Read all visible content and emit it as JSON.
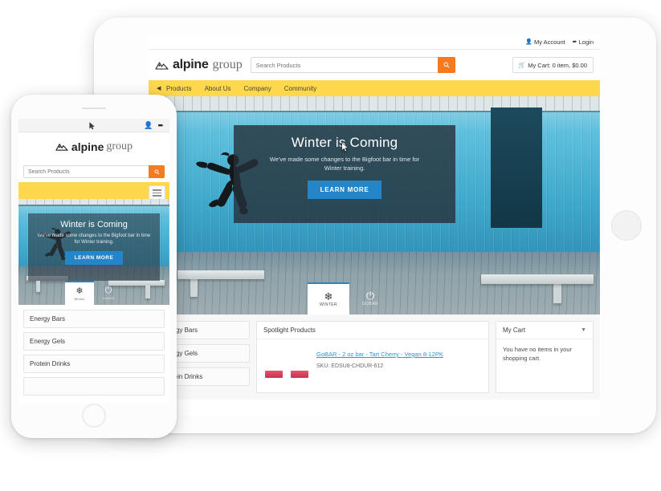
{
  "brand": {
    "name_bold": "alpine",
    "name_light": "group",
    "logo_icon": "mountain-icon"
  },
  "colors": {
    "nav_yellow": "#FFD84D",
    "search_orange": "#F47B20",
    "cta_blue": "#2585C9",
    "link_blue": "#2b96d8",
    "hero_overlay": "rgba(38,48,56,0.80)"
  },
  "tablet": {
    "utility": {
      "account_label": "My Account",
      "account_icon": "user-icon",
      "login_label": "Login",
      "login_icon": "sign-in-icon"
    },
    "search": {
      "placeholder": "Search Products",
      "value": "",
      "button_icon": "search-icon"
    },
    "cart_button": {
      "icon": "cart-icon",
      "label": "My Cart: 0 item, $0.00"
    },
    "nav": {
      "back_icon": "caret-left-icon",
      "items": [
        {
          "label": "Products"
        },
        {
          "label": "About Us"
        },
        {
          "label": "Company"
        },
        {
          "label": "Community"
        }
      ]
    },
    "hero": {
      "title": "Winter is Coming",
      "subtitle": "We've made some changes to the Bigfoot bar in time for Winter training.",
      "cta_label": "LEARN MORE",
      "cursor_icon": "mouse-pointer-icon"
    },
    "carousel_tabs": [
      {
        "label": "WINTER",
        "icon": "snowflake-icon",
        "active": true
      },
      {
        "label": "GOBAR",
        "icon": "power-icon",
        "active": false
      }
    ],
    "categories": [
      {
        "label": "Energy Bars"
      },
      {
        "label": "Energy Gels"
      },
      {
        "label": "Protein Drinks"
      }
    ],
    "spotlight": {
      "heading": "Spotlight Products",
      "product_name": "GoBAR - 2 oz bar - Tart Cherry - Vegan 8-12PK",
      "product_sku": "SKU: EDSU8-CHDUR-612"
    },
    "mycart": {
      "heading": "My Cart",
      "caret_icon": "chevron-down-icon",
      "empty_text": "You have no items in your shopping cart."
    }
  },
  "phone": {
    "utility": {
      "account_icon": "user-icon",
      "login_icon": "sign-in-icon",
      "cursor_icon": "mouse-pointer-icon"
    },
    "search": {
      "placeholder": "Search Products",
      "value": "",
      "button_icon": "search-icon"
    },
    "menu_icon": "hamburger-menu-icon",
    "hero": {
      "title": "Winter is Coming",
      "subtitle": "We've made some changes to the Bigfoot bar in time for Winter training.",
      "cta_label": "LEARN MORE"
    },
    "carousel_tabs": [
      {
        "label": "Winter",
        "icon": "snowflake-icon",
        "active": true
      },
      {
        "label": "GoBAR",
        "icon": "power-icon",
        "active": false
      }
    ],
    "categories": [
      {
        "label": "Energy Bars"
      },
      {
        "label": "Energy Gels"
      },
      {
        "label": "Protein Drinks"
      }
    ]
  }
}
